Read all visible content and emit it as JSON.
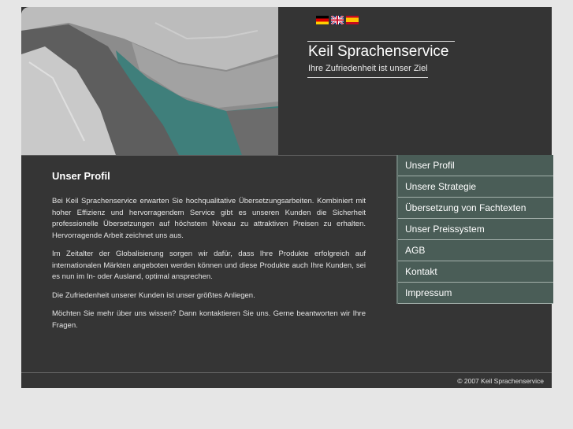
{
  "header": {
    "title": "Keil Sprachenservice",
    "tagline": "Ihre Zufriedenheit ist unser Ziel",
    "languages": [
      {
        "icon": "german-flag-icon"
      },
      {
        "icon": "uk-flag-icon"
      },
      {
        "icon": "spanish-flag-icon"
      }
    ]
  },
  "main": {
    "heading": "Unser Profil",
    "paragraphs": [
      "Bei Keil Sprachenservice erwarten Sie hochqualitative Übersetzungsarbeiten. Kombiniert mit hoher Effizienz und hervorragendem Service gibt es unseren Kunden die Sicherheit professionelle Übersetzungen auf höchstem Niveau  zu attraktiven Preisen zu erhalten. Hervorragende Arbeit zeichnet uns aus.",
      "Im Zeitalter der Globalisierung sorgen wir dafür, dass  Ihre Produkte erfolgreich auf internationalen Märkten angeboten werden können und diese Produkte auch Ihre Kunden, sei es nun im In- oder Ausland, optimal ansprechen.",
      "Die Zufriedenheit unserer Kunden ist unser größtes Anliegen.",
      "Möchten Sie mehr über uns wissen? Dann kontaktieren Sie uns. Gerne beantworten wir Ihre Fragen."
    ]
  },
  "nav": {
    "items": [
      {
        "label": "Unser Profil"
      },
      {
        "label": "Unsere Strategie"
      },
      {
        "label": "Übersetzung von Fachtexten"
      },
      {
        "label": "Unser Preissystem"
      },
      {
        "label": "AGB"
      },
      {
        "label": "Kontakt"
      },
      {
        "label": "Impressum"
      }
    ]
  },
  "footer": {
    "copyright": "© 2007 Keil Sprachenservice"
  },
  "colors": {
    "page_background": "#e6e6e6",
    "panel": "#353535",
    "nav_item": "#4a5d57",
    "water": "#3f7f7b"
  }
}
